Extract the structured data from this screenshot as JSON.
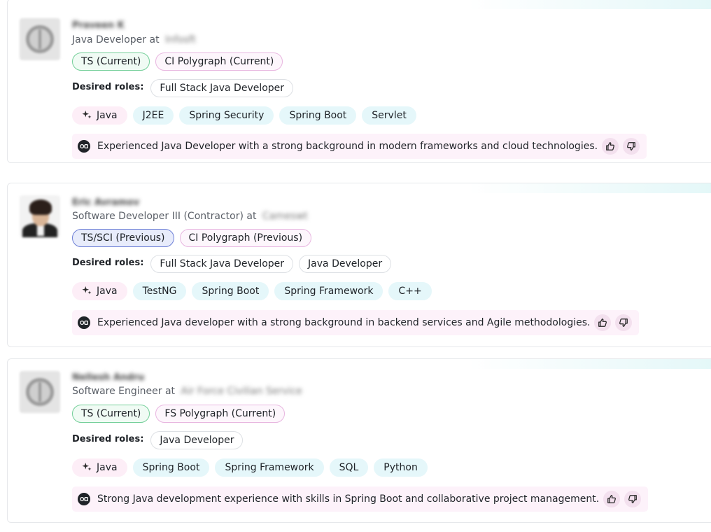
{
  "labels": {
    "desired_roles": "Desired roles:"
  },
  "candidates": [
    {
      "name": "Praveen K",
      "title": "Java Developer",
      "at": "at",
      "company": "Infosft",
      "avatar": "default-avatar",
      "clearances": [
        {
          "label": "TS (Current)",
          "color": "green"
        },
        {
          "label": "CI Polygraph (Current)",
          "color": "pink"
        }
      ],
      "desired_roles": [
        "Full Stack Java Developer"
      ],
      "skills": [
        "Java",
        "J2EE",
        "Spring Security",
        "Spring Boot",
        "Servlet"
      ],
      "summary": "Experienced Java Developer with a strong background in modern frameworks and cloud technologies."
    },
    {
      "name": "Eric Avramov",
      "title": "Software Developer III (Contractor)",
      "at": "at",
      "company": "Cameswt",
      "avatar": "photo-avatar",
      "clearances": [
        {
          "label": "TS/SCI (Previous)",
          "color": "blue"
        },
        {
          "label": "CI Polygraph (Previous)",
          "color": "pink"
        }
      ],
      "desired_roles": [
        "Full Stack Java Developer",
        "Java Developer"
      ],
      "skills": [
        "Java",
        "TestNG",
        "Spring Boot",
        "Spring Framework",
        "C++"
      ],
      "summary": "Experienced Java developer with a strong background in backend services and Agile methodologies."
    },
    {
      "name": "Nellesh Andru",
      "title": "Software Engineer",
      "at": "at",
      "company": "Air Force Civilian Service",
      "avatar": "default-avatar",
      "clearances": [
        {
          "label": "TS (Current)",
          "color": "green"
        },
        {
          "label": "FS Polygraph (Current)",
          "color": "pink"
        }
      ],
      "desired_roles": [
        "Java Developer"
      ],
      "skills": [
        "Java",
        "Spring Boot",
        "Spring Framework",
        "SQL",
        "Python"
      ],
      "summary": "Strong Java development experience with skills in Spring Boot and collaborative project management."
    }
  ],
  "colors": {
    "green": "#74cf99",
    "pink": "#e8b6e0",
    "blue": "#6d7fd6",
    "skill_bg": "#e5f7fa",
    "ai_skill_bg": "#fdeef7",
    "summary_bg": "#fdf2fa"
  },
  "icons": {
    "ai_skill": "sparkle-icon",
    "summary_logo": "ai-logo-icon",
    "like": "thumbs-up-icon",
    "dislike": "thumbs-down-icon"
  }
}
